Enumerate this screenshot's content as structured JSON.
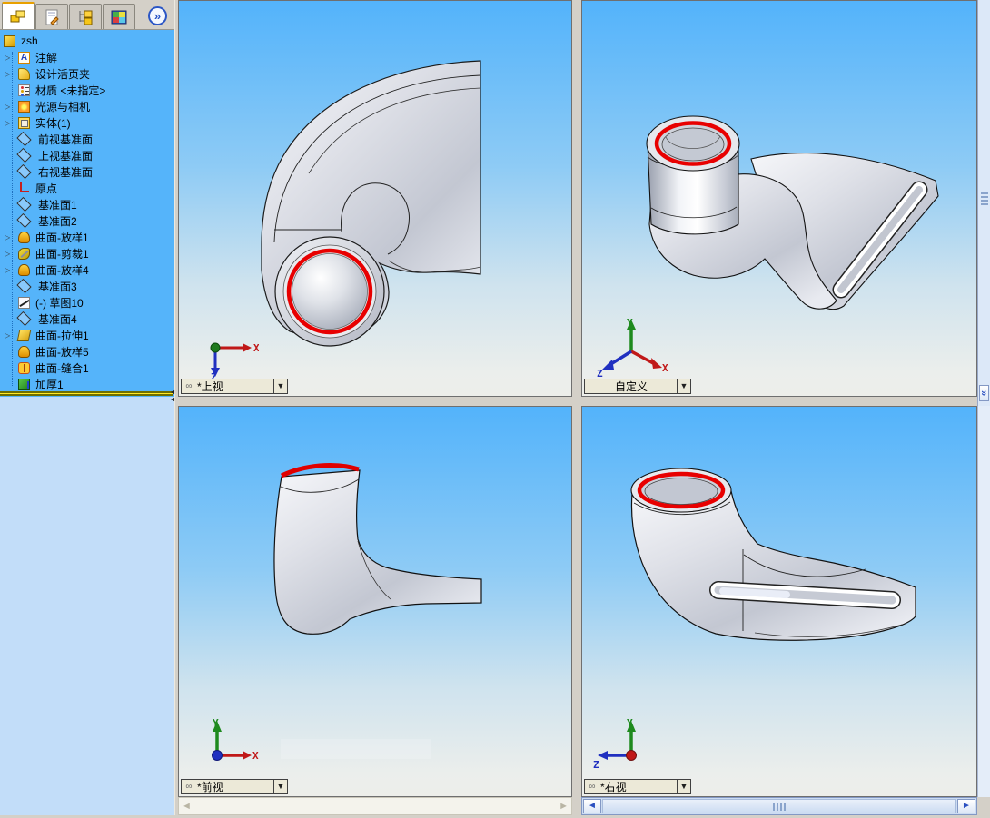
{
  "app_title": "SolidWorks part document",
  "icons": {
    "expand": "▷",
    "link": "∞",
    "dropdown": "▼",
    "scroll_left": "◄",
    "scroll_right": "►",
    "chevrons": "»",
    "splitter_arrow": "◄",
    "glyphs": {
      "annotations": "A"
    }
  },
  "triad": {
    "x": "X",
    "y": "Y",
    "z": "Z"
  },
  "colors": {
    "tree_bg": "#55b4fa",
    "viewport_sky_top": "#53b3fb",
    "viewport_sky_bottom": "#edeeea",
    "highlight_edge_red": "#e80000",
    "rollback_yellow": "#ffe926",
    "chrome_grey": "#d4d0c8",
    "combo_beige": "#ece9d8"
  },
  "left_panel": {
    "expand_glyph": "»",
    "tabs": [
      {
        "name": "featuremanager-tab",
        "active": true
      },
      {
        "name": "propertymanager-tab",
        "active": false
      },
      {
        "name": "configurationmanager-tab",
        "active": false
      },
      {
        "name": "dimxpertmanager-tab",
        "active": false
      }
    ],
    "tree": {
      "root": {
        "label": "zsh",
        "icon": "part"
      },
      "items": [
        {
          "label": "注解",
          "icon": "annotations",
          "expandable": true
        },
        {
          "label": "设计活页夹",
          "icon": "design-binder",
          "expandable": true
        },
        {
          "label": "材质 <未指定>",
          "icon": "material",
          "expandable": false
        },
        {
          "label": "光源与相机",
          "icon": "lights",
          "expandable": true
        },
        {
          "label": "实体(1)",
          "icon": "solid-bodies",
          "expandable": true
        },
        {
          "label": "前视基准面",
          "icon": "plane",
          "expandable": false
        },
        {
          "label": "上视基准面",
          "icon": "plane",
          "expandable": false
        },
        {
          "label": "右视基准面",
          "icon": "plane",
          "expandable": false
        },
        {
          "label": "原点",
          "icon": "origin",
          "expandable": false
        },
        {
          "label": "基准面1",
          "icon": "plane",
          "expandable": false
        },
        {
          "label": "基准面2",
          "icon": "plane",
          "expandable": false
        },
        {
          "label": "曲面-放样1",
          "icon": "surface-loft",
          "expandable": true
        },
        {
          "label": "曲面-剪裁1",
          "icon": "surface-trim",
          "expandable": true
        },
        {
          "label": "曲面-放样4",
          "icon": "surface-loft",
          "expandable": true
        },
        {
          "label": "基准面3",
          "icon": "plane",
          "expandable": false
        },
        {
          "label": "(-) 草图10",
          "icon": "sketch",
          "expandable": false
        },
        {
          "label": "基准面4",
          "icon": "plane",
          "expandable": false
        },
        {
          "label": "曲面-拉伸1",
          "icon": "surface-extrude",
          "expandable": true
        },
        {
          "label": "曲面-放样5",
          "icon": "surface-loft",
          "expandable": false
        },
        {
          "label": "曲面-缝合1",
          "icon": "surface-knit",
          "expandable": false
        },
        {
          "label": "加厚1",
          "icon": "thicken",
          "expandable": false
        }
      ]
    }
  },
  "viewports": [
    {
      "id": "top-left",
      "view_label": "*上视",
      "linked": true
    },
    {
      "id": "top-right",
      "view_label": "自定义",
      "linked": false
    },
    {
      "id": "bottom-left",
      "view_label": "*前视",
      "linked": true
    },
    {
      "id": "bottom-right",
      "view_label": "*右视",
      "linked": true
    }
  ]
}
